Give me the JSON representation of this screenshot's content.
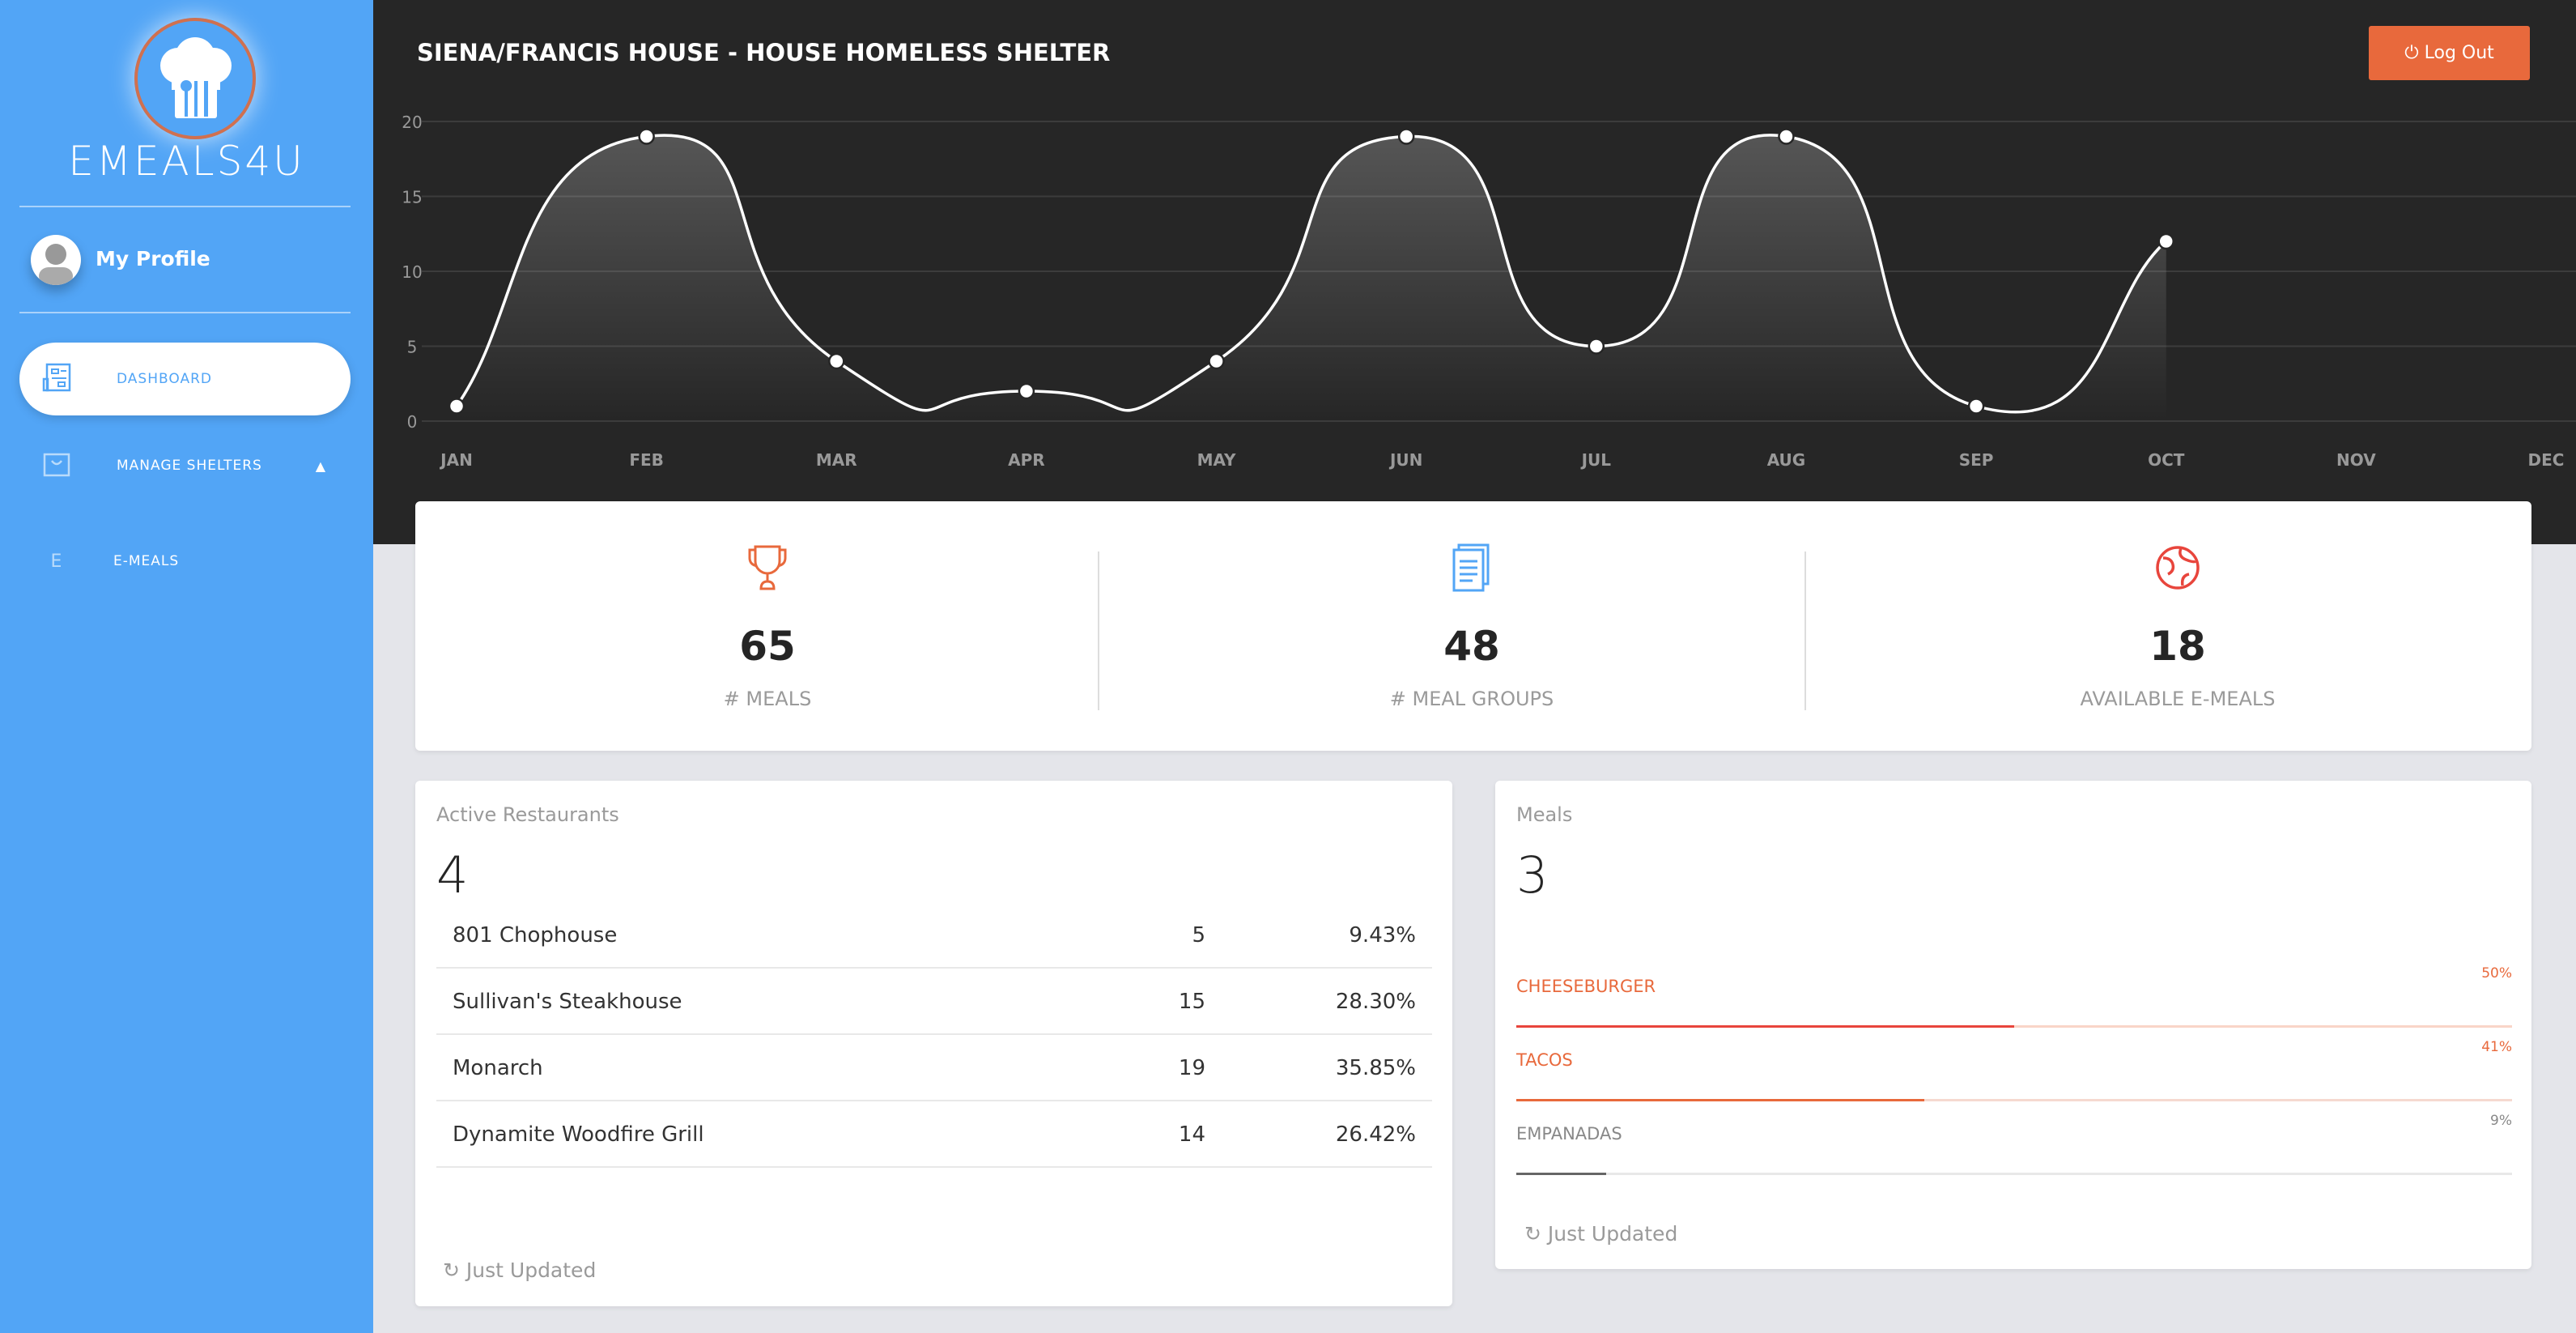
{
  "sidebar": {
    "brand": "EMEALS4U",
    "profile": "My Profile",
    "items": [
      {
        "label": "DASHBOARD",
        "icon": "newspaper-icon",
        "active": true
      },
      {
        "label": "MANAGE SHELTERS",
        "icon": "bag-icon"
      },
      {
        "label": "E-MEALS",
        "icon": "E"
      }
    ]
  },
  "header": {
    "title": "SIENA/FRANCIS HOUSE - HOUSE HOMELESS SHELTER",
    "logout": "Log Out"
  },
  "chart_data": {
    "type": "line",
    "categories": [
      "JAN",
      "FEB",
      "MAR",
      "APR",
      "MAY",
      "JUN",
      "JUL",
      "AUG",
      "SEP",
      "OCT",
      "NOV",
      "DEC"
    ],
    "values": [
      1,
      19,
      4,
      2,
      4,
      19,
      5,
      19,
      1,
      12,
      null,
      null
    ],
    "ylim": [
      0,
      20
    ],
    "yticks": [
      0,
      5,
      10,
      15,
      20
    ],
    "grid": true
  },
  "stats": [
    {
      "value": "65",
      "label": "# MEALS",
      "icon": "trophy-icon",
      "color": "#e8693c"
    },
    {
      "value": "48",
      "label": "# MEAL GROUPS",
      "icon": "document-icon",
      "color": "#52a5f6"
    },
    {
      "value": "18",
      "label": "AVAILABLE E-MEALS",
      "icon": "globe-icon",
      "color": "#e8453c"
    }
  ],
  "restaurants": {
    "title": "Active Restaurants",
    "count": "4",
    "rows": [
      {
        "name": "801 Chophouse",
        "count": "5",
        "pct": "9.43%"
      },
      {
        "name": "Sullivan's Steakhouse",
        "count": "15",
        "pct": "28.30%"
      },
      {
        "name": "Monarch",
        "count": "19",
        "pct": "35.85%"
      },
      {
        "name": "Dynamite Woodfire Grill",
        "count": "14",
        "pct": "26.42%"
      }
    ],
    "updated": "Just Updated"
  },
  "meals": {
    "title": "Meals",
    "count": "3",
    "items": [
      {
        "name": "CHEESEBURGER",
        "pct": "50%",
        "value": 50,
        "color": "#e8453c",
        "track": "#f9d5c8",
        "text": "#e8693c"
      },
      {
        "name": "TACOS",
        "pct": "41%",
        "value": 41,
        "color": "#e8693c",
        "track": "#f6d9d0",
        "text": "#e8693c"
      },
      {
        "name": "EMPANADAS",
        "pct": "9%",
        "value": 9,
        "color": "#666666",
        "track": "#e8e8e8",
        "text": "#888888"
      }
    ],
    "updated": "Just Updated"
  }
}
